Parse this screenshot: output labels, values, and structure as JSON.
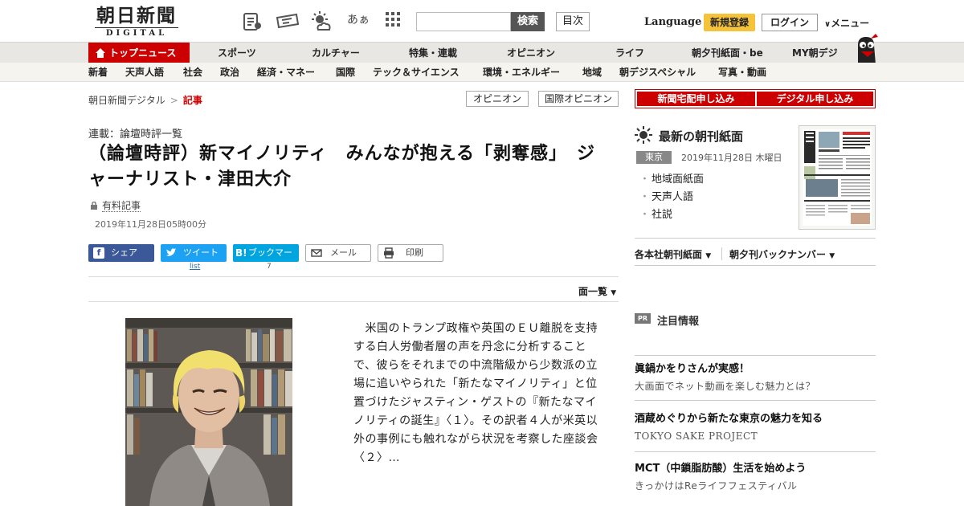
{
  "header": {
    "logo_jp": "朝日新聞",
    "logo_en": "DIGITAL",
    "font_size_label": "あぁ",
    "search_button": "検索",
    "toc_button": "目次",
    "language": "Language",
    "register": "新規登録",
    "login": "ログイン",
    "menu": "メニュー"
  },
  "nav_primary": {
    "top_news": "トップニュース",
    "items": [
      "スポーツ",
      "カルチャー",
      "特集・連載",
      "オピニオン",
      "ライフ",
      "朝夕刊紙面・be",
      "MY朝デジ"
    ]
  },
  "nav_secondary": {
    "items": [
      "新着",
      "天声人語",
      "社会",
      "政治",
      "経済・マネー",
      "国際",
      "テック＆サイエンス",
      "環境・エネルギー",
      "地域",
      "朝デジスペシャル",
      "写真・動画"
    ]
  },
  "breadcrumb": {
    "home": "朝日新聞デジタル",
    "separator": ">",
    "current": "記事"
  },
  "tags": [
    "オピニオン",
    "国際オピニオン"
  ],
  "article": {
    "series": "連載：論壇時評一覧",
    "title": "（論壇時評）新マイノリティ　みんなが抱える「剥奪感」　ジャーナリスト・津田大介",
    "paid_label": "有料記事",
    "date": "2019年11月28日05時00分",
    "body": "　米国のトランプ政権や英国のＥＵ離脱を支持する白人労働者層の声を丹念に分析することで、彼らをそれまでの中流階級から少数派の立場に追いやられた「新たなマイノリティ」と位置づけたジャスティン・ゲストの『新たなマイノリティの誕生』〈１〉。その訳者４人が米英以外の事例にも触れながら状況を考察した座談会〈２〉…",
    "page_menu": "面一覧"
  },
  "share": {
    "facebook": "シェア",
    "twitter": "ツイート",
    "hatena": "ブックマーク",
    "mail": "メール",
    "print": "印刷",
    "twitter_count": "list",
    "hatena_count": "7"
  },
  "sidebar": {
    "subscribe_paper": "新聞宅配申し込み",
    "subscribe_digital": "デジタル申し込み",
    "morning_title": "最新の朝刊紙面",
    "region": "東京",
    "morning_date": "2019年11月28日 木曜日",
    "morning_links": [
      "地域面紙面",
      "天声人語",
      "社説"
    ],
    "regional_pages": "各本社朝刊紙面",
    "backnumber": "朝夕刊バックナンバー",
    "pr_tag": "PR",
    "pr_title": "注目情報",
    "ads": [
      {
        "title": "眞鍋かをりさんが実感！",
        "sub": "大画面でネット動画を楽しむ魅力とは？"
      },
      {
        "title": "酒蔵めぐりから新たな東京の魅力を知る",
        "sub": "TOKYO SAKE PROJECT"
      },
      {
        "title": "MCT（中鎖脂肪酸）生活を始めよう",
        "sub": "きっかけはReライフフェスティバル"
      }
    ]
  },
  "colors": {
    "brand_red": "#cc0000",
    "facebook": "#3b5998",
    "twitter": "#1da1f2",
    "hatena": "#00a4de",
    "register_yellow": "#f4c33a"
  },
  "icons": [
    "newspaper-icon",
    "ticket-icon",
    "weather-icon",
    "grid-menu-icon",
    "home-icon",
    "mascot-icon",
    "lock-icon",
    "sun-icon",
    "print-icon",
    "mail-icon"
  ]
}
